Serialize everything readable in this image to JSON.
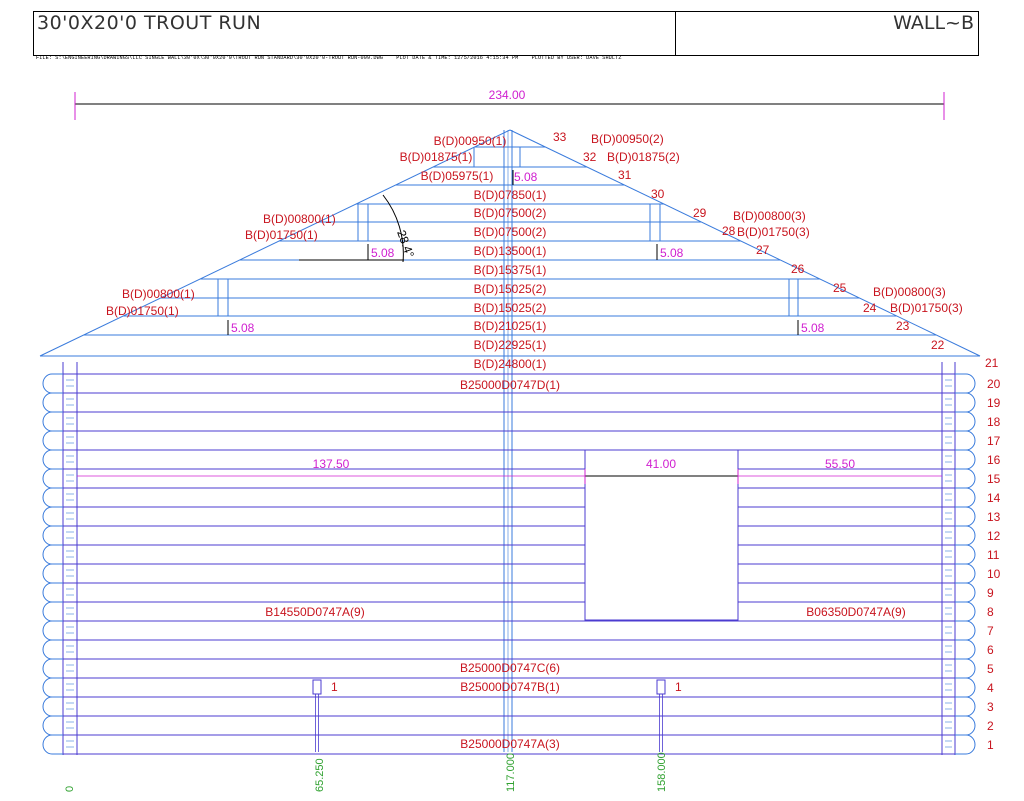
{
  "title_block": {
    "project": "30'0X20'0 TROUT RUN",
    "wall": "WALL~B",
    "file": "FILE: S:\\ENGINEERING\\DRAWINGS\\LLC SINGLE WALL\\30'0X\\30'0X20'0\\TROUT RUN STANDARD\\30'0X20'0-TROUT RUN-009.DWG",
    "plot_date": "PLOT DATE & TIME: 12/5/2016 4:15:34 PM",
    "plotted_by": "PLOTTED BY USER: DAVE SHULTZ"
  },
  "colors": {
    "frame": "#000000",
    "gable_lines": "#3a7bdc",
    "wall_lines": "#4b3bd0",
    "labels": "#c8141e",
    "dims": "#d020d0",
    "baseline": "#2fa12f",
    "black": "#000000"
  },
  "dimensions": {
    "overall": "234.00",
    "left_span": "137.50",
    "opening": "41.00",
    "right_span": "55.50",
    "gap_top": "5.08",
    "gap_upper_left": "5.08",
    "gap_upper_right": "5.08",
    "gap_mid_left": "5.08",
    "gap_mid_right": "5.08",
    "angle": "28.4°"
  },
  "gable_logs": [
    "B(D)00950(1)",
    "B(D)01875(1)",
    "B(D)05975(1)",
    "B(D)07850(1)",
    "B(D)07500(2)",
    "B(D)07500(2)",
    "B(D)13500(1)",
    "B(D)15375(1)",
    "B(D)15025(2)",
    "B(D)15025(2)",
    "B(D)21025(1)",
    "B(D)22925(1)",
    "B(D)24800(1)"
  ],
  "side_labels": {
    "top_right_a": "B(D)00950(2)",
    "top_right_b": "B(D)01875(2)",
    "upper_left_a": "B(D)00800(1)",
    "upper_left_b": "B(D)01750(1)",
    "upper_right_a": "B(D)00800(3)",
    "upper_right_b": "B(D)01750(3)",
    "mid_left_a": "B(D)00800(1)",
    "mid_left_b": "B(D)01750(1)",
    "mid_right_a": "B(D)00800(3)",
    "mid_right_b": "B(D)01750(3)"
  },
  "gable_numbers": [
    "21",
    "22",
    "23",
    "24",
    "25",
    "26",
    "27",
    "28",
    "29",
    "30",
    "31",
    "32",
    "33"
  ],
  "wall_logs": {
    "course20": "B25000D0747D(1)",
    "left8": "B14550D0747A(9)",
    "right8": "B06350D0747A(9)",
    "course5": "B25000D0747C(6)",
    "course4": "B25000D0747B(1)",
    "course1": "B25000D0747A(3)"
  },
  "wall_rows": [
    "20",
    "19",
    "18",
    "17",
    "16",
    "15",
    "14",
    "13",
    "12",
    "11",
    "10",
    "9",
    "8",
    "7",
    "6",
    "5",
    "4",
    "3",
    "2",
    "1"
  ],
  "post_labels": [
    "1",
    "1"
  ],
  "baseline_marks": [
    "0",
    "65.250",
    "117.000",
    "158.000"
  ]
}
